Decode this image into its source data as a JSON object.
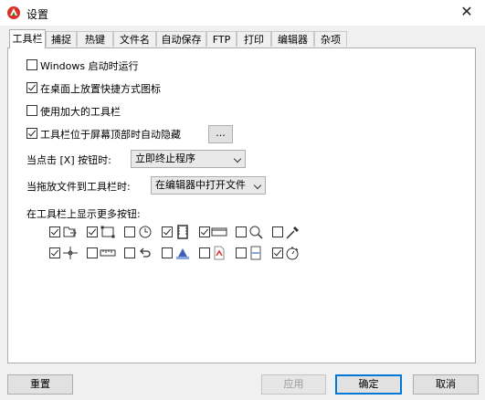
{
  "window": {
    "title": "设置",
    "close": "✕"
  },
  "tabs": [
    {
      "label": "工具栏",
      "active": true
    },
    {
      "label": "捕捉"
    },
    {
      "label": "热键"
    },
    {
      "label": "文件名"
    },
    {
      "label": "自动保存"
    },
    {
      "label": "FTP"
    },
    {
      "label": "打印"
    },
    {
      "label": "编辑器"
    },
    {
      "label": "杂项"
    }
  ],
  "options": [
    {
      "label": "Windows 启动时运行",
      "checked": false
    },
    {
      "label": "在桌面上放置快捷方式图标",
      "checked": true
    },
    {
      "label": "使用加大的工具栏",
      "checked": false
    },
    {
      "label": "工具栏位于屏幕顶部时自动隐藏",
      "checked": true
    }
  ],
  "more_button": "...",
  "close_action": {
    "label": "当点击 [X] 按钮时:",
    "value": "立即终止程序"
  },
  "drop_action": {
    "label": "当拖放文件到工具栏时:",
    "value": "在编辑器中打开文件"
  },
  "more_buttons_label": "在工具栏上显示更多按钮:",
  "toolbar_buttons": [
    {
      "icon": "open-icon",
      "checked": true
    },
    {
      "icon": "region-icon",
      "checked": true
    },
    {
      "icon": "timer-icon",
      "checked": false
    },
    {
      "icon": "filmstrip-icon",
      "checked": true
    },
    {
      "icon": "window-icon",
      "checked": true
    },
    {
      "icon": "magnifier-icon",
      "checked": false
    },
    {
      "icon": "eyedropper-icon",
      "checked": false
    },
    {
      "icon": "crosshair-icon",
      "checked": true
    },
    {
      "icon": "ruler-icon",
      "checked": false
    },
    {
      "icon": "undo-icon",
      "checked": false
    },
    {
      "icon": "printer-icon",
      "checked": false
    },
    {
      "icon": "pdf-icon",
      "checked": false
    },
    {
      "icon": "split-icon",
      "checked": false
    },
    {
      "icon": "stopwatch-icon",
      "checked": true
    }
  ],
  "footer": {
    "reset": "重置",
    "apply": "应用",
    "ok": "确定",
    "cancel": "取消"
  }
}
